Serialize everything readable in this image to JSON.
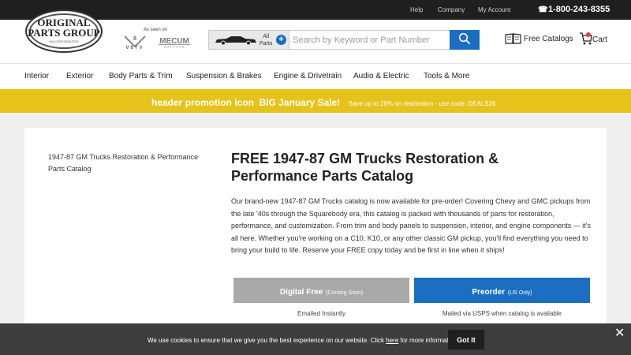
{
  "topbar": {
    "links": [
      "Help",
      "Company",
      "My Account"
    ],
    "phone": "1-800-243-8355",
    "phone_icon": "phone-icon"
  },
  "header": {
    "logo_line1": "ORIGINAL",
    "logo_line2": "PARTS GROUP",
    "logo_line3": "INCORPORATED",
    "as_seen_on": "As seen on",
    "search": {
      "vehicle_label_1": "All",
      "vehicle_label_2": "Parts",
      "plus": "+",
      "placeholder": "Search by Keyword or Part Number"
    },
    "catalogs": "Free Catalogs",
    "cart": "Cart"
  },
  "nav": {
    "items": [
      "Interior",
      "Exterior",
      "Body Parts & Trim",
      "Suspension & Brakes",
      "Engine & Drivetrain",
      "Audio & Electric",
      "Tools & More"
    ]
  },
  "promo": {
    "icon_text": "header promotion icon",
    "headline": "BIG January Sale!",
    "subtext": "Save up to 26% on restoration - use code: DEALS26"
  },
  "main": {
    "breadcrumb": "1947-87 GM Trucks Restoration & Performance Parts Catalog",
    "title": "FREE 1947-87 GM Trucks Restoration & Performance Parts Catalog",
    "description": "Our brand-new 1947-87 GM Trucks catalog is now available for pre-order! Covering Chevy and GMC pickups from the late '40s through the Squarebody era, this catalog is packed with thousands of parts for restoration, performance, and customization. From trim and body panels to suspension, interior, and engine components — it's all here. Whether you're working on a C10, K10, or any other classic GM pickup, you'll find everything you need to bring your build to life. Reserve your FREE copy today and be first in line when it ships!",
    "digital_label": "Digital Free",
    "digital_sub": "(Coming Soon)",
    "digital_note": "Emailed Instantly",
    "preorder_label": "Preorder",
    "preorder_sub": "(US Only)",
    "preorder_note": "Mailed via USPS when catalog is available"
  },
  "cookie": {
    "text_before": "We use cookies to ensure that we give you the best experience on our website. Click ",
    "link": "here",
    "text_after": " for more information.",
    "button": "Got It",
    "close": "✕"
  },
  "colors": {
    "accent": "#1b6ec2",
    "promo": "#e6c31a",
    "topbar": "#1f1f1f",
    "cookie": "#3d3d3d"
  }
}
